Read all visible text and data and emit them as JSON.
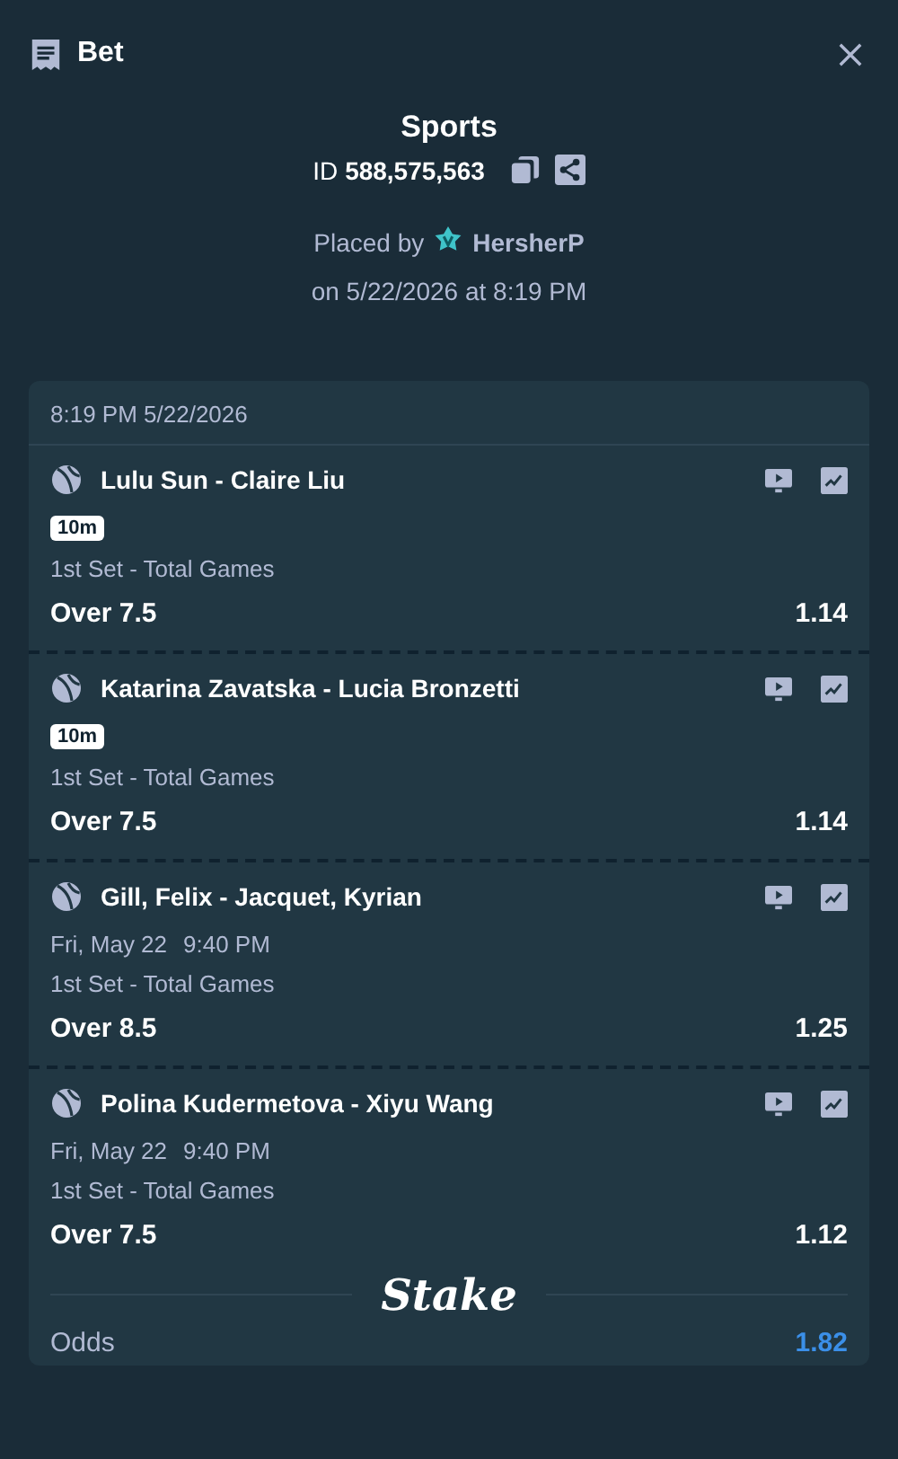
{
  "header": {
    "title": "Bet"
  },
  "summary": {
    "category": "Sports",
    "id_label": "ID",
    "id_value": "588,575,563",
    "placed_by": "Placed by",
    "user": "HersherP",
    "placed_on": "on 5/22/2026 at 8:19 PM"
  },
  "slip": {
    "timestamp": "8:19 PM 5/22/2026",
    "legs": [
      {
        "match": "Lulu Sun - Claire Liu",
        "badge": "10m",
        "market": "1st Set - Total Games",
        "selection": "Over 7.5",
        "odds": "1.14"
      },
      {
        "match": "Katarina Zavatska - Lucia Bronzetti",
        "badge": "10m",
        "market": "1st Set - Total Games",
        "selection": "Over 7.5",
        "odds": "1.14"
      },
      {
        "match": "Gill, Felix - Jacquet, Kyrian",
        "start_date": "Fri, May 22",
        "start_time": "9:40 PM",
        "market": "1st Set - Total Games",
        "selection": "Over 8.5",
        "odds": "1.25"
      },
      {
        "match": "Polina Kudermetova - Xiyu Wang",
        "start_date": "Fri, May 22",
        "start_time": "9:40 PM",
        "market": "1st Set - Total Games",
        "selection": "Over 7.5",
        "odds": "1.12"
      }
    ],
    "logo": "Stake",
    "totals": [
      {
        "label": "Odds",
        "value": "1.82"
      }
    ]
  }
}
